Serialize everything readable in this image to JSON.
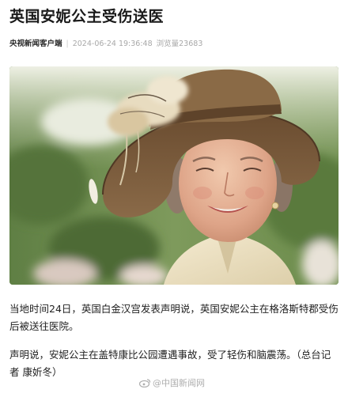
{
  "article": {
    "title": "英国安妮公主受伤送医",
    "source": "央视新闻客户端",
    "separator": "|",
    "timestamp": "2024-06-24 19:36:48",
    "views_label": "浏览量",
    "views_count": "23683",
    "paragraphs": [
      "当地时间24日，英国白金汉宫发表声明说，英国安妮公主在格洛斯特郡受伤后被送往医院。",
      "声明说，安妮公主在盖特康比公园遭遇事故，受了轻伤和脑震荡。（总台记者 康妡冬）"
    ],
    "watermark": "@中国新闻网"
  },
  "photo": {
    "subject": "portrait of a smiling woman in a feathered hat",
    "palette": {
      "background_green": "#6f8f4e",
      "hat_brown": "#7a5a3a",
      "jacket_cream": "#efe4c8"
    }
  },
  "icons": {
    "watermark_logo": "weibo-icon"
  }
}
